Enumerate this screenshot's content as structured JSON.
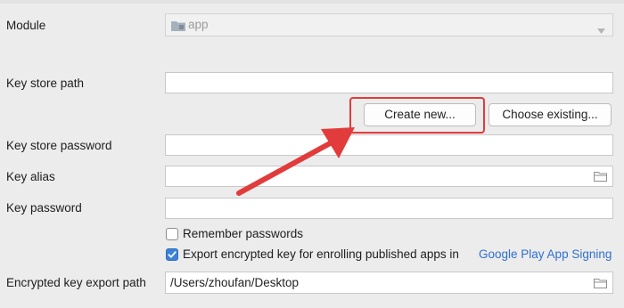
{
  "labels": {
    "module": "Module",
    "key_store_path": "Key store path",
    "key_store_password": "Key store password",
    "key_alias": "Key alias",
    "key_password": "Key password",
    "encrypted_export_path": "Encrypted key export path"
  },
  "module_select": {
    "value": "app",
    "icon": "folder-module-icon"
  },
  "buttons": {
    "create_new": "Create new...",
    "choose_existing": "Choose existing..."
  },
  "checkboxes": {
    "remember_passwords": {
      "label": "Remember passwords",
      "checked": false
    },
    "export_encrypted": {
      "label": "Export encrypted key for enrolling published apps in",
      "checked": true
    }
  },
  "link": {
    "google_play_signing": "Google Play App Signing"
  },
  "export_path": {
    "value": "/Users/zhoufan/Desktop"
  },
  "colors": {
    "annotation_red": "#e23b3b",
    "link_blue": "#2f6fd1",
    "checkbox_blue": "#3b82d6"
  }
}
